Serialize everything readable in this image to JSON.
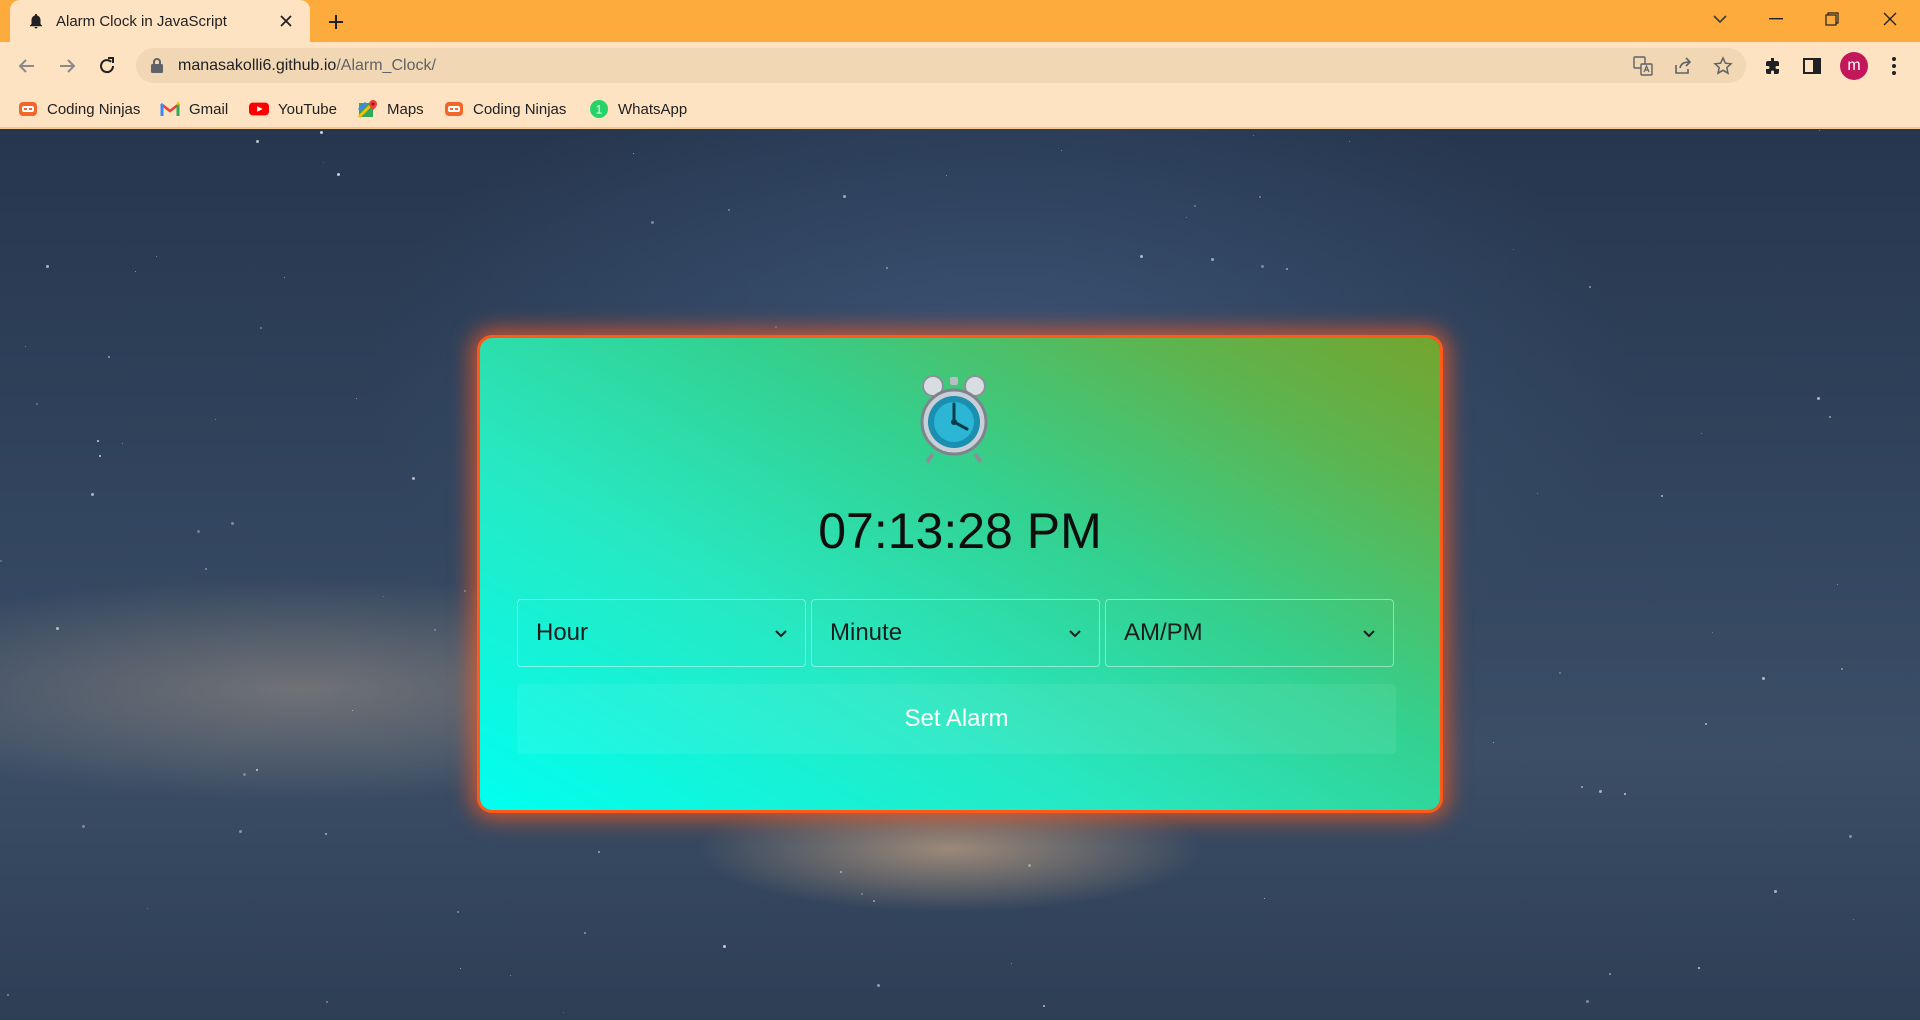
{
  "browser": {
    "tab": {
      "title": "Alarm Clock in JavaScript",
      "icon": "bell-icon"
    },
    "address": {
      "host": "manasakolli6.github.io",
      "path": "/Alarm_Clock/"
    },
    "avatar_letter": "m",
    "bookmarks": [
      {
        "label": "Coding Ninjas",
        "icon": "coding-ninjas-icon"
      },
      {
        "label": "Gmail",
        "icon": "gmail-icon"
      },
      {
        "label": "YouTube",
        "icon": "youtube-icon"
      },
      {
        "label": "Maps",
        "icon": "maps-icon"
      },
      {
        "label": "Coding Ninjas",
        "icon": "coding-ninjas-icon"
      },
      {
        "label": "WhatsApp",
        "icon": "whatsapp-icon"
      }
    ],
    "colors": {
      "tabstrip": "#fdab3d",
      "toolbar": "#fde3c1",
      "avatar": "#c2185b"
    }
  },
  "app": {
    "current_time": "07:13:28 PM",
    "selects": [
      {
        "label": "Hour"
      },
      {
        "label": "Minute"
      },
      {
        "label": "AM/PM"
      }
    ],
    "set_alarm_label": "Set Alarm",
    "colors": {
      "card_start": "#00fff0",
      "card_end": "#74a52e",
      "glow": "#ff5a1a"
    }
  }
}
